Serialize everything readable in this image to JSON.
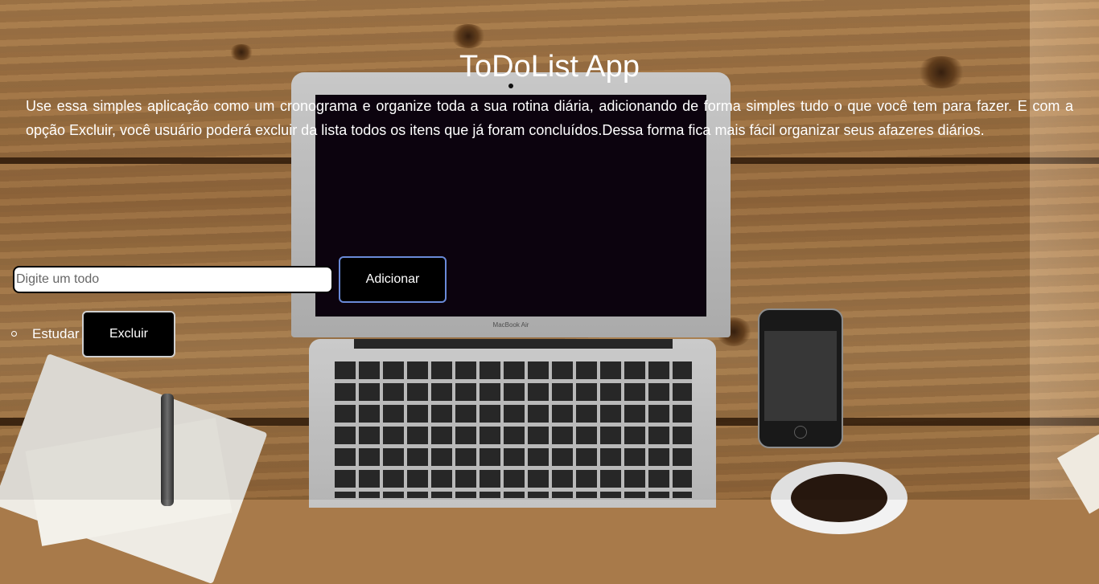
{
  "app": {
    "title": "ToDoList App",
    "description": "Use essa simples aplicação como um cronograma e organize toda a sua rotina diária, adicionando de forma simples tudo o que você tem para fazer. E com a opção Excluir, você usuário poderá excluir da lista todos os itens que já foram concluídos.Dessa forma fica mais fácil organizar seus afazeres diários."
  },
  "form": {
    "input_placeholder": "Digite um todo",
    "input_value": "",
    "add_label": "Adicionar"
  },
  "todos": [
    {
      "text": "Estudar",
      "delete_label": "Excluir"
    }
  ],
  "background": {
    "laptop_brand": "MacBook Air"
  },
  "colors": {
    "text": "#ffffff",
    "button_bg": "#000000",
    "add_button_border": "#6a8ad8",
    "delete_button_border": "#d0d0d0"
  }
}
